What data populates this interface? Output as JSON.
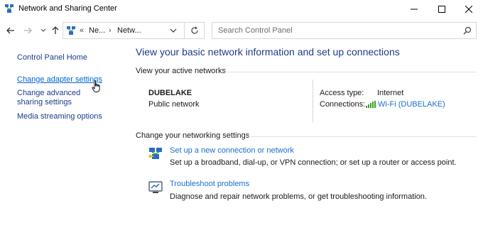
{
  "window": {
    "title": "Network and Sharing Center",
    "controls": [
      "minimize",
      "maximize",
      "close"
    ]
  },
  "address_bar": {
    "prefix": "«",
    "crumbs": [
      "Ne...",
      "Netw..."
    ],
    "separator": "›"
  },
  "search": {
    "placeholder": "Search Control Panel"
  },
  "sidebar": {
    "items": [
      {
        "label": "Control Panel Home"
      },
      {
        "label": "Change adapter settings"
      },
      {
        "label": "Change advanced sharing settings"
      },
      {
        "label": "Media streaming options"
      }
    ]
  },
  "main": {
    "heading": "View your basic network information and set up connections",
    "active_networks_header": "View your active networks",
    "network": {
      "name": "DUBELAKE",
      "type": "Public network",
      "access_type_label": "Access type:",
      "access_type_value": "Internet",
      "connections_label": "Connections:",
      "connections_value": "Wi-Fi (DUBELAKE)"
    },
    "change_settings_header": "Change your networking settings",
    "tasks": [
      {
        "icon": "new-connection-icon",
        "link": "Set up a new connection or network",
        "description": "Set up a broadband, dial-up, or VPN connection; or set up a router or access point."
      },
      {
        "icon": "troubleshoot-icon",
        "link": "Troubleshoot problems",
        "description": "Diagnose and repair network problems, or get troubleshooting information."
      }
    ]
  },
  "colors": {
    "heading": "#1e3a8a",
    "link": "#1a6fcf",
    "wifi_bars": "#3aa02a"
  }
}
